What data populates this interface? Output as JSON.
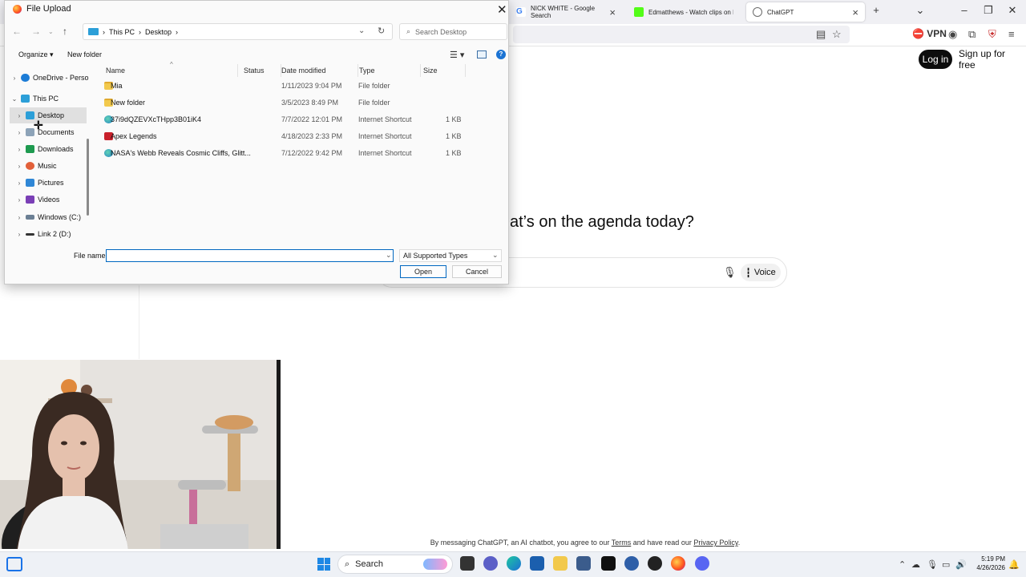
{
  "browser": {
    "tabs": [
      {
        "label": "NICK WHITE - Google Search",
        "favicon_color": "#4285f4"
      },
      {
        "label": "Edmatthews - Watch clips on Ki",
        "favicon_color": "#53fc18"
      },
      {
        "label": "ChatGPT",
        "favicon_color": "#6b6b6b"
      }
    ],
    "new_tab": "+",
    "vpn_label": "VPN"
  },
  "chatgpt": {
    "login_label": "Log in",
    "signup_label": "Sign up for free",
    "headline": "at’s on the agenda today?",
    "voice_label": "Voice",
    "footer_prefix": "By messaging ChatGPT, an AI chatbot, you agree to our ",
    "footer_terms": "Terms",
    "footer_middle": " and have read our ",
    "footer_privacy": "Privacy Policy",
    "footer_suffix": "."
  },
  "dialog": {
    "title": "File Upload",
    "breadcrumb": [
      "This PC",
      "Desktop"
    ],
    "search_placeholder": "Search Desktop",
    "organize_label": "Organize",
    "new_folder_label": "New folder",
    "nav_items": [
      {
        "label": "OneDrive - Perso",
        "icon": "cloud-icon",
        "color": "#1c7cd6"
      },
      {
        "label": "This PC",
        "icon": "computer-icon",
        "color": "#2c9fd8"
      },
      {
        "label": "Desktop",
        "icon": "desktop-icon",
        "color": "#2c9fd8",
        "selected": true
      },
      {
        "label": "Documents",
        "icon": "documents-icon",
        "color": "#8da3b8"
      },
      {
        "label": "Downloads",
        "icon": "download-icon",
        "color": "#1e9a4f"
      },
      {
        "label": "Music",
        "icon": "music-icon",
        "color": "#e2603a"
      },
      {
        "label": "Pictures",
        "icon": "pictures-icon",
        "color": "#2f87d6"
      },
      {
        "label": "Videos",
        "icon": "videos-icon",
        "color": "#7a3fb6"
      },
      {
        "label": "Windows (C:)",
        "icon": "drive-icon",
        "color": "#6b7f94"
      },
      {
        "label": "Link 2 (D:)",
        "icon": "drive-icon",
        "color": "#333333"
      }
    ],
    "columns": [
      "Name",
      "Status",
      "Date modified",
      "Type",
      "Size"
    ],
    "files": [
      {
        "name": "Mia",
        "date": "1/11/2023 9:04 PM",
        "type": "File folder",
        "size": "",
        "icon": "folder-icon"
      },
      {
        "name": "New folder",
        "date": "3/5/2023 8:49 PM",
        "type": "File folder",
        "size": "",
        "icon": "folder-icon"
      },
      {
        "name": "37i9dQZEVXcTHpp3B01iK4",
        "date": "7/7/2022 12:01 PM",
        "type": "Internet Shortcut",
        "size": "1 KB",
        "icon": "web-link-icon"
      },
      {
        "name": "Apex Legends",
        "date": "4/18/2023 2:33 PM",
        "type": "Internet Shortcut",
        "size": "1 KB",
        "icon": "apex-icon"
      },
      {
        "name": "NASA's Webb Reveals Cosmic Cliffs, Glitt...",
        "date": "7/12/2022 9:42 PM",
        "type": "Internet Shortcut",
        "size": "1 KB",
        "icon": "web-link-icon"
      }
    ],
    "file_name_label": "File name:",
    "file_name_value": "",
    "filter_value": "All Supported Types",
    "open_label": "Open",
    "cancel_label": "Cancel"
  },
  "taskbar": {
    "search_label": "Search",
    "time": "5:19 PM",
    "date": "4/26/2026"
  }
}
